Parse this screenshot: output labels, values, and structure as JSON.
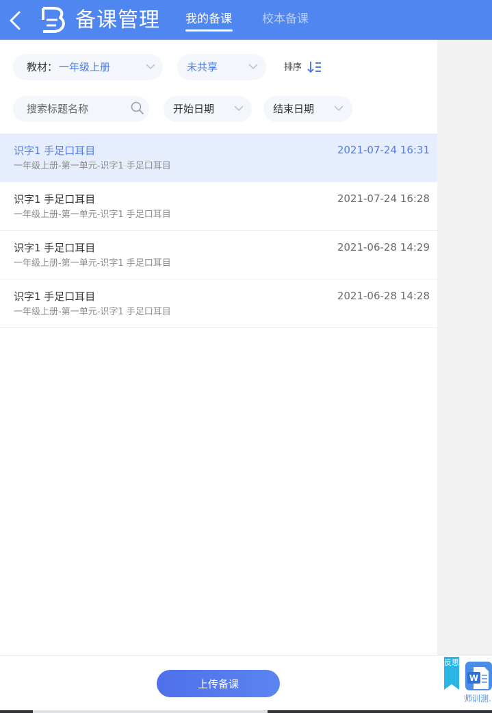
{
  "header": {
    "title": "备课管理",
    "tabs": [
      {
        "label": "我的备课",
        "active": true
      },
      {
        "label": "校本备课",
        "active": false
      }
    ]
  },
  "filters": {
    "textbook_label": "教材：",
    "textbook_value": "一年级上册",
    "share_value": "未共享",
    "sort_label": "排序",
    "search_placeholder": "搜索标题名称",
    "start_date": "开始日期",
    "end_date": "结束日期"
  },
  "list": [
    {
      "title": "识字1 手足口耳目",
      "path": "一年级上册-第一单元-识字1 手足口耳目",
      "date": "2021-07-24 16:31",
      "selected": true
    },
    {
      "title": "识字1 手足口耳目",
      "path": "一年级上册-第一单元-识字1 手足口耳目",
      "date": "2021-07-24 16:28",
      "selected": false
    },
    {
      "title": "识字1 手足口耳目",
      "path": "一年级上册-第一单元-识字1 手足口耳目",
      "date": "2021-06-28 14:29",
      "selected": false
    },
    {
      "title": "识字1 手足口耳目",
      "path": "一年级上册-第一单元-识字1 手足口耳目",
      "date": "2021-06-28 14:28",
      "selected": false
    }
  ],
  "footer": {
    "upload_label": "上传备课",
    "reflect_label": "反思",
    "word_label": "师训测.",
    "word_icon_letter": "W"
  },
  "colors": {
    "header": "#4f86f0",
    "accent": "#4f7be8",
    "selected_row": "#e6eefd",
    "side_panel": "#f2f2f2",
    "reflect_tag": "#2bb5e5"
  },
  "icons": [
    "back-arrow-icon",
    "app-logo-icon",
    "chevron-down-icon",
    "sort-icon",
    "search-icon",
    "reflect-bookmark-icon",
    "word-document-icon"
  ]
}
